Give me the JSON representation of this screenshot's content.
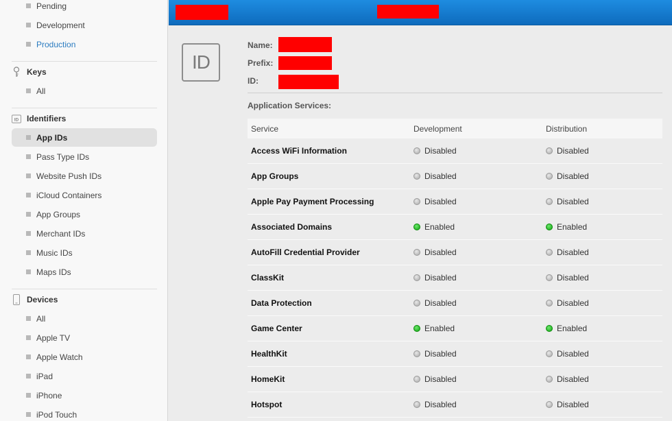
{
  "sidebar": {
    "certificates_items": [
      {
        "label": "Pending"
      },
      {
        "label": "Development"
      },
      {
        "label": "Production"
      }
    ],
    "keys": {
      "title": "Keys",
      "items": [
        {
          "label": "All"
        }
      ]
    },
    "identifiers": {
      "title": "Identifiers",
      "items": [
        {
          "label": "App IDs"
        },
        {
          "label": "Pass Type IDs"
        },
        {
          "label": "Website Push IDs"
        },
        {
          "label": "iCloud Containers"
        },
        {
          "label": "App Groups"
        },
        {
          "label": "Merchant IDs"
        },
        {
          "label": "Music IDs"
        },
        {
          "label": "Maps IDs"
        }
      ]
    },
    "devices": {
      "title": "Devices",
      "items": [
        {
          "label": "All"
        },
        {
          "label": "Apple TV"
        },
        {
          "label": "Apple Watch"
        },
        {
          "label": "iPad"
        },
        {
          "label": "iPhone"
        },
        {
          "label": "iPod Touch"
        }
      ]
    }
  },
  "detail": {
    "badge": "ID",
    "name_label": "Name:",
    "prefix_label": "Prefix:",
    "id_label": "ID:",
    "services_title": "Application Services:",
    "columns": [
      "Service",
      "Development",
      "Distribution"
    ],
    "services": [
      {
        "name": "Access WiFi Information",
        "dev": "Disabled",
        "dist": "Disabled"
      },
      {
        "name": "App Groups",
        "dev": "Disabled",
        "dist": "Disabled"
      },
      {
        "name": "Apple Pay Payment Processing",
        "dev": "Disabled",
        "dist": "Disabled"
      },
      {
        "name": "Associated Domains",
        "dev": "Enabled",
        "dist": "Enabled"
      },
      {
        "name": "AutoFill Credential Provider",
        "dev": "Disabled",
        "dist": "Disabled"
      },
      {
        "name": "ClassKit",
        "dev": "Disabled",
        "dist": "Disabled"
      },
      {
        "name": "Data Protection",
        "dev": "Disabled",
        "dist": "Disabled"
      },
      {
        "name": "Game Center",
        "dev": "Enabled",
        "dist": "Enabled"
      },
      {
        "name": "HealthKit",
        "dev": "Disabled",
        "dist": "Disabled"
      },
      {
        "name": "HomeKit",
        "dev": "Disabled",
        "dist": "Disabled"
      },
      {
        "name": "Hotspot",
        "dev": "Disabled",
        "dist": "Disabled"
      }
    ]
  },
  "colors": {
    "header_blue": "#1478d0",
    "link_blue": "#2a7bc0",
    "enabled_green": "#19b019",
    "redaction_red": "#ff0000"
  }
}
